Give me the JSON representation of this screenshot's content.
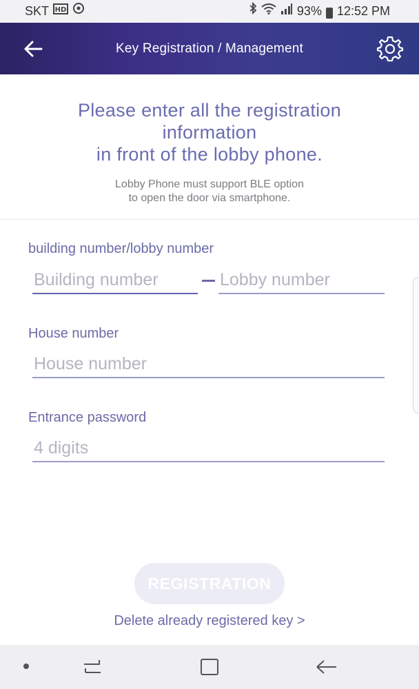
{
  "status_bar": {
    "carrier": "SKT",
    "battery": "93%",
    "time": "12:52 PM"
  },
  "header": {
    "title": "Key Registration / Management",
    "back_icon": "arrow-left-icon",
    "settings_icon": "gear-icon"
  },
  "intro": {
    "title_line1": "Please enter all the registration",
    "title_line2": "information",
    "title_line3": "in front of the lobby phone.",
    "sub_line1": "Lobby Phone must support BLE option",
    "sub_line2": "to open the door via smartphone."
  },
  "form": {
    "building_label": "building number/lobby number",
    "building_placeholder": "Building number",
    "lobby_placeholder": "Lobby number",
    "house_label": "House number",
    "house_placeholder": "House number",
    "password_label": "Entrance password",
    "password_placeholder": "4 digits"
  },
  "actions": {
    "register_label": "REGISTRATION",
    "delete_link": "Delete already registered key >"
  },
  "colors": {
    "accent": "#6b6ba8",
    "header_start": "#2b2363",
    "header_end": "#2f3a84"
  }
}
